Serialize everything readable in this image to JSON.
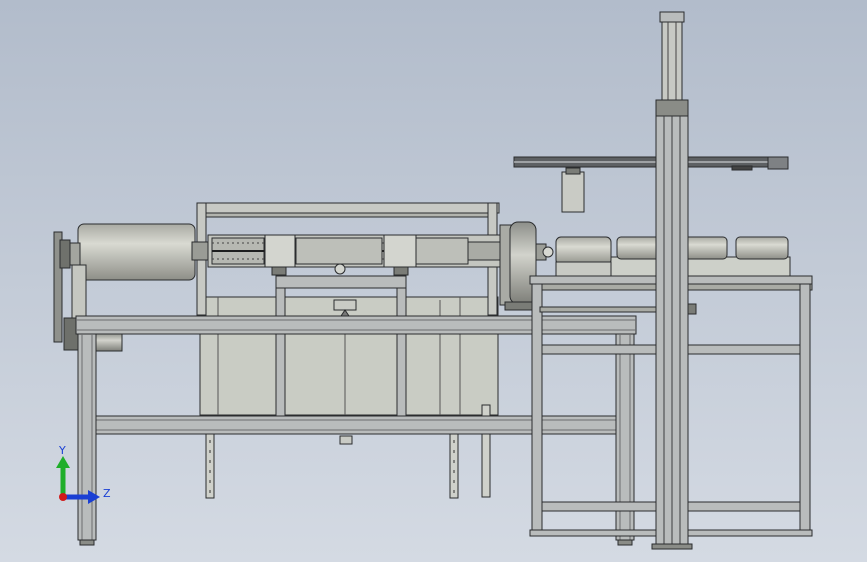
{
  "viewport": {
    "background_top": "#b2bccb",
    "background_bottom": "#d4dae3"
  },
  "model": {
    "frame_color": "#b9bcbc",
    "frame_edge_color": "#2a2c2e",
    "panel_color": "#c9ccc4",
    "roller_color": "#c2c3bb",
    "dark_part_color": "#5a5d60"
  },
  "triad": {
    "y_label": "Y",
    "z_label": "Z",
    "y_color": "#1fae2a",
    "z_color": "#1a3fd4",
    "x_color": "#d11a1a"
  }
}
